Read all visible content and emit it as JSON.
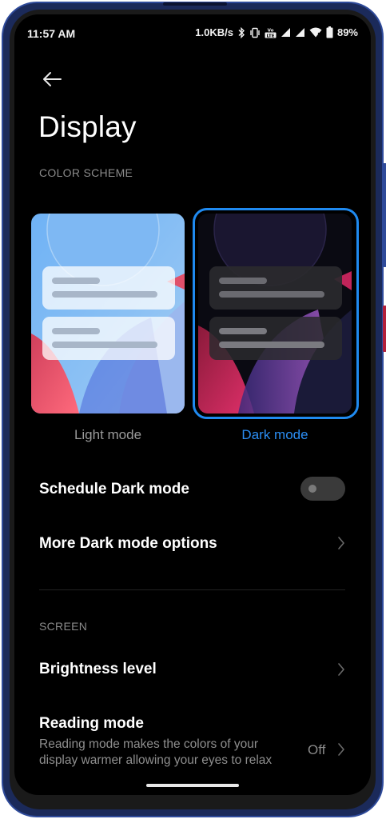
{
  "status_bar": {
    "time": "11:57 AM",
    "net_speed": "1.0KB/s",
    "battery": "89%",
    "icons": [
      "bluetooth-icon",
      "vibrate-icon",
      "volte-icon",
      "signal-icon",
      "signal-icon",
      "wifi-icon",
      "battery-icon"
    ]
  },
  "header": {
    "back_icon": "arrow-left-icon",
    "title": "Display"
  },
  "color_scheme": {
    "section_label": "COLOR SCHEME",
    "options": [
      {
        "label": "Light mode",
        "selected": false
      },
      {
        "label": "Dark mode",
        "selected": true
      }
    ]
  },
  "settings": {
    "schedule_dark": {
      "label": "Schedule Dark mode",
      "enabled": false
    },
    "more_dark_options": {
      "label": "More Dark mode options"
    }
  },
  "screen_section": {
    "section_label": "SCREEN",
    "brightness": {
      "label": "Brightness level"
    },
    "reading_mode": {
      "label": "Reading mode",
      "description": "Reading mode makes the colors of your display warmer allowing your eyes to relax",
      "value": "Off"
    }
  },
  "colors": {
    "accent": "#2b8df3",
    "background": "#000000",
    "secondary_text": "#8a8a8a"
  }
}
